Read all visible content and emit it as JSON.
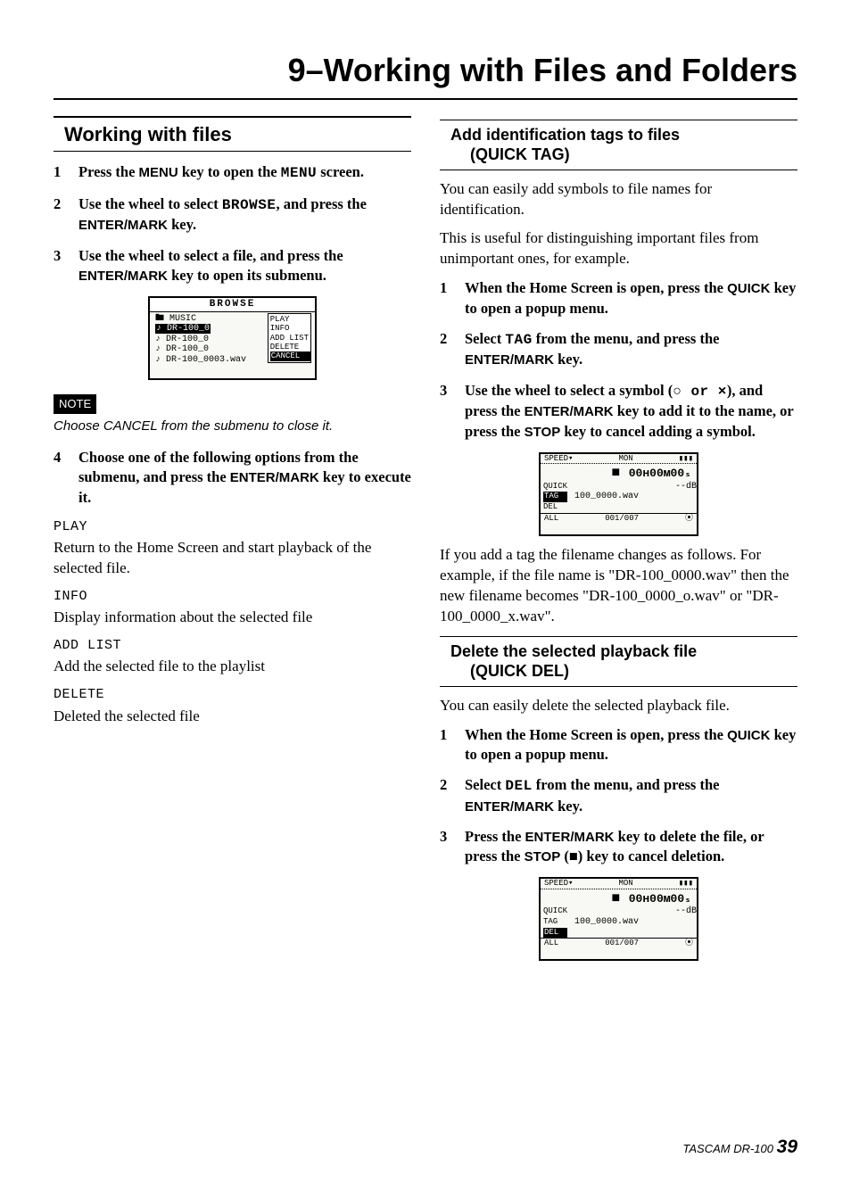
{
  "chapter": "9–Working with Files and Folders",
  "left": {
    "section": "Working with files",
    "steps_a": [
      {
        "pre": "Press the ",
        "k1": "MENU",
        "mid": " key to open the ",
        "lcd": "MENU",
        "post": " screen."
      },
      {
        "pre": "Use the wheel to select ",
        "lcd": "BROWSE",
        "mid": ", and press the ",
        "k1": "ENTER/MARK",
        "post": " key."
      },
      {
        "pre": "Use the wheel to select a file, and press the ",
        "k1": "ENTER/MARK",
        "post": " key to open its submenu."
      }
    ],
    "lcd_browse": {
      "title": "BROWSE",
      "rows": [
        "🖿 MUSIC",
        "♪ DR-100_0",
        "♪ DR-100_0",
        "♪ DR-100_0",
        "♪ DR-100_0003.wav"
      ],
      "popup": [
        "PLAY",
        "INFO",
        "ADD LIST",
        "DELETE",
        "CANCEL"
      ]
    },
    "note_label": "NOTE",
    "note_text": "Choose CANCEL from the submenu to close it.",
    "step4": {
      "num": "4",
      "pre": "Choose one of the following options from the submenu, and press the ",
      "k1": "ENTER/MARK",
      "post": " key to execute it."
    },
    "options": [
      {
        "name": "PLAY",
        "desc": "Return to the Home Screen and start playback of the selected file."
      },
      {
        "name": "INFO",
        "desc": "Display information about the selected file"
      },
      {
        "name": "ADD LIST",
        "desc": "Add the selected file to the playlist"
      },
      {
        "name": "DELETE",
        "desc": "Deleted the selected file"
      }
    ]
  },
  "right": {
    "tag": {
      "heading_l1": "Add identification tags to files",
      "heading_l2": "(QUICK TAG)",
      "intro1": "You can easily add symbols to file names for identification.",
      "intro2": "This is useful for distinguishing important files from unimportant ones, for example.",
      "steps": [
        {
          "pre": "When the Home Screen is open, press the ",
          "k1": "QUICK",
          "post": " key to open a popup menu."
        },
        {
          "pre": "Select ",
          "lcd": "TAG",
          "mid": " from the menu, and press the ",
          "k1": "ENTER/MARK",
          "post": " key."
        },
        {
          "pre": "Use the wheel to select a symbol (",
          "sym": "○ or ×",
          "mid": "), and press the ",
          "k1": "ENTER/MARK",
          "mid2": " key to add it to the name, or press the ",
          "k2": "STOP",
          "post": " key to cancel adding a symbol."
        }
      ],
      "lcd": {
        "top_l": "SPEED▾",
        "top_m": "MON",
        "time": "00ʜ00ᴍ00ₛ",
        "side": [
          "QUICK",
          "TAG",
          "DEL"
        ],
        "file": "100_0000.wav",
        "db": "--dB",
        "foot_l": "ALL",
        "foot_m": "001/007"
      },
      "after": "If you add a tag the filename changes as follows. For example, if the file name is \"DR-100_0000.wav\" then the new filename becomes \"DR-100_0000_o.wav\" or \"DR-100_0000_x.wav\"."
    },
    "del": {
      "heading_l1": "Delete the selected playback file",
      "heading_l2": "(QUICK DEL)",
      "intro": "You can easily delete the selected playback file.",
      "steps": [
        {
          "pre": "When the Home Screen is open, press the ",
          "k1": "QUICK",
          "post": " key to open a popup menu."
        },
        {
          "pre": "Select ",
          "lcd": "DEL",
          "mid": " from the menu, and press the ",
          "k1": "ENTER/MARK",
          "post": " key."
        },
        {
          "pre": "Press the ",
          "k1": "ENTER/MARK",
          "mid": " key to delete the file, or press the ",
          "k2": "STOP",
          "sym": " (■)",
          "post": " key to cancel deletion."
        }
      ],
      "lcd": {
        "top_l": "SPEED▾",
        "top_m": "MON",
        "time": "00ʜ00ᴍ00ₛ",
        "side": [
          "QUICK",
          "TAG",
          "DEL"
        ],
        "file": "100_0000.wav",
        "db": "--dB",
        "foot_l": "ALL",
        "foot_m": "001/007"
      }
    }
  },
  "footer": {
    "brand": "TASCAM DR-100",
    "page": "39"
  }
}
